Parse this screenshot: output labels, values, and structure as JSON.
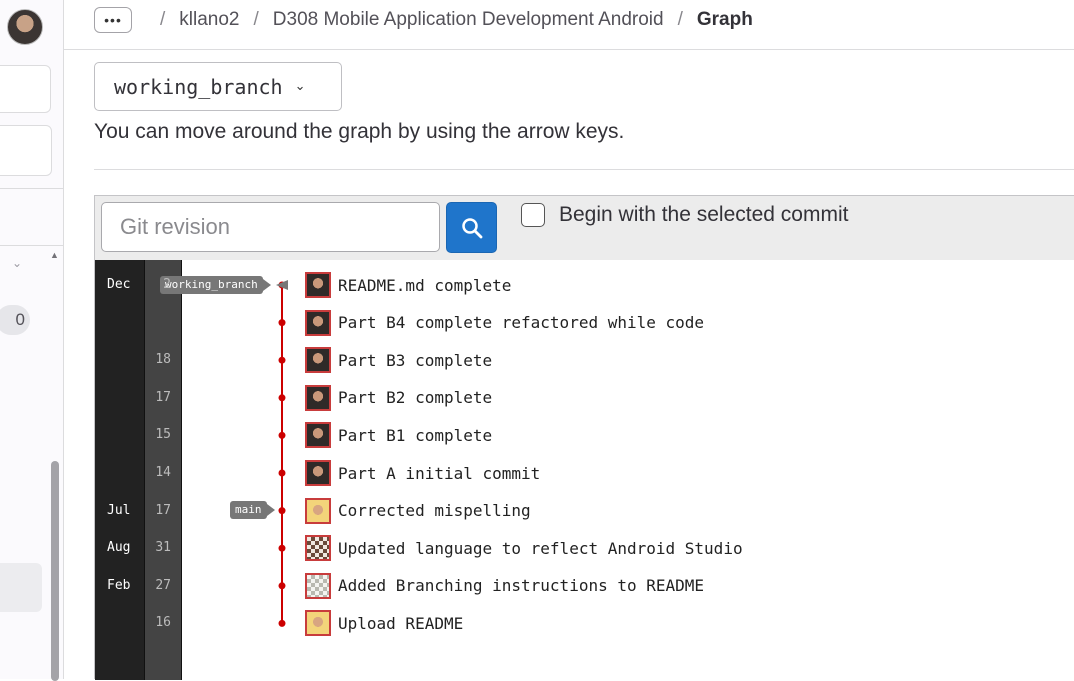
{
  "breadcrumb": {
    "more_label": "•••",
    "items": [
      "kllano2",
      "D308 Mobile Application Development Android",
      "Graph"
    ]
  },
  "sidebar": {
    "count_badge": "0"
  },
  "branch_select": {
    "value": "working_branch"
  },
  "hint": "You can move around the graph by using the arrow keys.",
  "search": {
    "placeholder": "Git revision",
    "value": ""
  },
  "begin_checkbox": {
    "label": "Begin with the selected commit",
    "checked": false
  },
  "refs": {
    "head": "working_branch",
    "main": "main"
  },
  "colors": {
    "graph_line": "#cc0000",
    "search_button": "#1f75cb",
    "month_column": "#222222",
    "day_column": "#444444"
  },
  "commits": [
    {
      "month": "Dec",
      "day": "2",
      "message": "README.md complete",
      "avatar": "user-photo"
    },
    {
      "month": "",
      "day": "",
      "message": "Part B4 complete refactored while code",
      "avatar": "user-photo"
    },
    {
      "month": "",
      "day": "18",
      "message": "Part B3 complete",
      "avatar": "user-photo"
    },
    {
      "month": "",
      "day": "17",
      "message": "Part B2 complete",
      "avatar": "user-photo"
    },
    {
      "month": "",
      "day": "15",
      "message": "Part B1 complete",
      "avatar": "user-photo"
    },
    {
      "month": "",
      "day": "14",
      "message": "Part A initial commit",
      "avatar": "user-photo"
    },
    {
      "month": "Jul",
      "day": "17",
      "message": "Corrected mispelling",
      "avatar": "instructor-photo"
    },
    {
      "month": "Aug",
      "day": "31",
      "message": "Updated language to reflect Android Studio",
      "avatar": "identicon-brown"
    },
    {
      "month": "Feb",
      "day": "27",
      "message": "Added Branching instructions to README",
      "avatar": "identicon-gray"
    },
    {
      "month": "",
      "day": "16",
      "message": "Upload README",
      "avatar": "instructor-photo"
    }
  ]
}
